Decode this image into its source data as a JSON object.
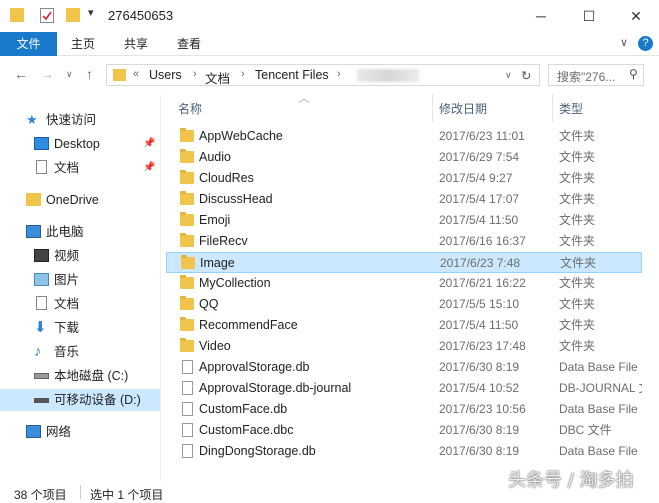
{
  "window": {
    "title": "276450653",
    "minimize": "─",
    "maximize": "☐",
    "close": "✕"
  },
  "ribbon": {
    "tabs": [
      "文件",
      "主页",
      "共享",
      "查看"
    ],
    "expand": "∨",
    "help": "?"
  },
  "address": {
    "overflow": "«",
    "crumbs": [
      "Users",
      "文档",
      "Tencent Files"
    ],
    "search_placeholder": "搜索\"276...",
    "refresh": "↻"
  },
  "sidebar": {
    "quick_access": "快速访问",
    "items_quick": [
      {
        "label": "Desktop",
        "pinned": true
      },
      {
        "label": "文档",
        "pinned": true
      }
    ],
    "onedrive": "OneDrive",
    "this_pc": "此电脑",
    "pc_items": [
      "视频",
      "图片",
      "文档",
      "下载",
      "音乐",
      "本地磁盘 (C:)",
      "可移动设备 (D:)"
    ],
    "network": "网络"
  },
  "columns": {
    "name": "名称",
    "date": "修改日期",
    "type": "类型"
  },
  "files": [
    {
      "name": "AppWebCache",
      "date": "2017/6/23 11:01",
      "type": "文件夹",
      "kind": "folder"
    },
    {
      "name": "Audio",
      "date": "2017/6/29 7:54",
      "type": "文件夹",
      "kind": "folder"
    },
    {
      "name": "CloudRes",
      "date": "2017/5/4 9:27",
      "type": "文件夹",
      "kind": "folder"
    },
    {
      "name": "DiscussHead",
      "date": "2017/5/4 17:07",
      "type": "文件夹",
      "kind": "folder"
    },
    {
      "name": "Emoji",
      "date": "2017/5/4 11:50",
      "type": "文件夹",
      "kind": "folder"
    },
    {
      "name": "FileRecv",
      "date": "2017/6/16 16:37",
      "type": "文件夹",
      "kind": "folder"
    },
    {
      "name": "Image",
      "date": "2017/6/23 7:48",
      "type": "文件夹",
      "kind": "folder",
      "selected": true
    },
    {
      "name": "MyCollection",
      "date": "2017/6/21 16:22",
      "type": "文件夹",
      "kind": "folder"
    },
    {
      "name": "QQ",
      "date": "2017/5/5 15:10",
      "type": "文件夹",
      "kind": "folder"
    },
    {
      "name": "RecommendFace",
      "date": "2017/5/4 11:50",
      "type": "文件夹",
      "kind": "folder"
    },
    {
      "name": "Video",
      "date": "2017/6/23 17:48",
      "type": "文件夹",
      "kind": "folder"
    },
    {
      "name": "ApprovalStorage.db",
      "date": "2017/6/30 8:19",
      "type": "Data Base File",
      "kind": "db"
    },
    {
      "name": "ApprovalStorage.db-journal",
      "date": "2017/5/4 10:52",
      "type": "DB-JOURNAL 文件",
      "kind": "file"
    },
    {
      "name": "CustomFace.db",
      "date": "2017/6/23 10:56",
      "type": "Data Base File",
      "kind": "db"
    },
    {
      "name": "CustomFace.dbc",
      "date": "2017/6/30 8:19",
      "type": "DBC 文件",
      "kind": "file"
    },
    {
      "name": "DingDongStorage.db",
      "date": "2017/6/30 8:19",
      "type": "Data Base File",
      "kind": "db"
    }
  ],
  "status": {
    "count": "38 个项目",
    "selected": "选中 1 个项目"
  },
  "watermark": "头条号 / 淘多拍"
}
